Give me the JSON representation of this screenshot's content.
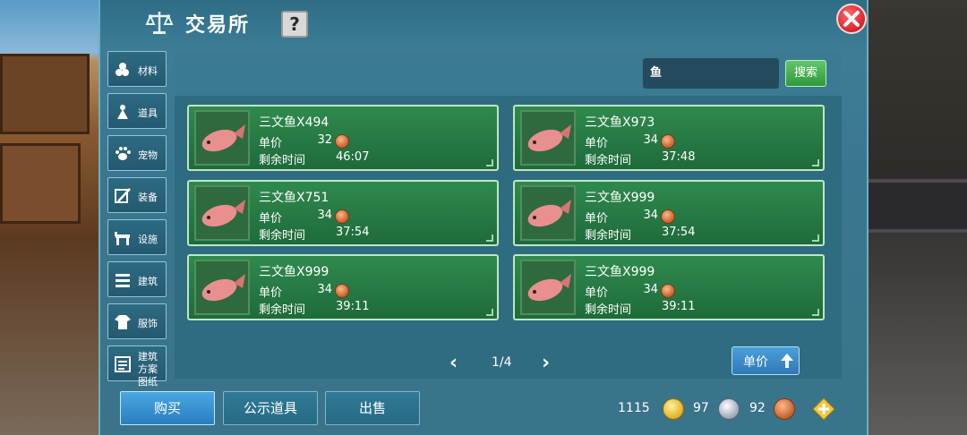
{
  "window": {
    "title": "交易所",
    "help_label": "?",
    "close_icon": "close-icon"
  },
  "categories": [
    {
      "label": "材料",
      "icon": "materials-icon"
    },
    {
      "label": "道具",
      "icon": "props-icon"
    },
    {
      "label": "宠物",
      "icon": "paw-icon"
    },
    {
      "label": "装备",
      "icon": "equipment-icon"
    },
    {
      "label": "设施",
      "icon": "facility-icon"
    },
    {
      "label": "建筑",
      "icon": "building-icon"
    },
    {
      "label": "服饰",
      "icon": "clothing-icon"
    },
    {
      "label": "建筑方案图纸",
      "icon": "blueprint-icon"
    }
  ],
  "search": {
    "value": "鱼",
    "button_label": "搜索"
  },
  "listings": [
    {
      "name": "三文鱼X494",
      "price_label": "单价",
      "price": "32",
      "time_label": "剩余时间",
      "time": "46:07"
    },
    {
      "name": "三文鱼X973",
      "price_label": "单价",
      "price": "34",
      "time_label": "剩余时间",
      "time": "37:48"
    },
    {
      "name": "三文鱼X751",
      "price_label": "单价",
      "price": "34",
      "time_label": "剩余时间",
      "time": "37:54"
    },
    {
      "name": "三文鱼X999",
      "price_label": "单价",
      "price": "34",
      "time_label": "剩余时间",
      "time": "37:54"
    },
    {
      "name": "三文鱼X999",
      "price_label": "单价",
      "price": "34",
      "time_label": "剩余时间",
      "time": "39:11"
    },
    {
      "name": "三文鱼X999",
      "price_label": "单价",
      "price": "34",
      "time_label": "剩余时间",
      "time": "39:11"
    }
  ],
  "pagination": {
    "prev": "‹",
    "next": "›",
    "current": "1/4"
  },
  "sort": {
    "label": "单价",
    "icon": "sort-arrow-icon"
  },
  "bottom_tabs": {
    "buy": "购买",
    "show": "公示道具",
    "sell": "出售"
  },
  "currency": {
    "gold": "1115",
    "silver": "97",
    "copper": "92"
  },
  "colors": {
    "panel": "#3b7690",
    "card": "#2f8a4e",
    "search_button": "#2f9a3b",
    "buy_button": "#2a7dc0",
    "close_button": "#d3242a"
  }
}
